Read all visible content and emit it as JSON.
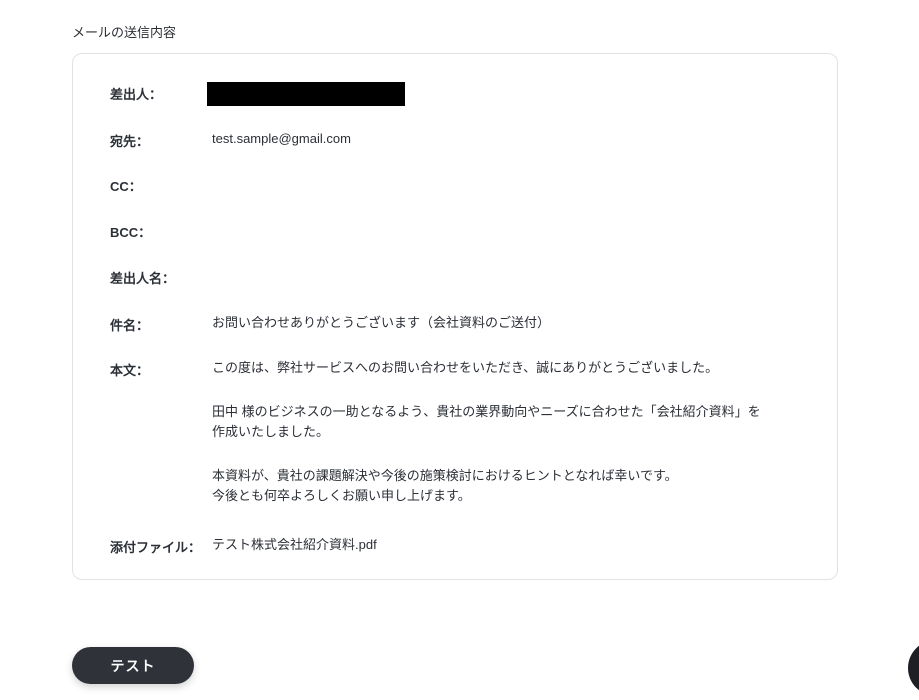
{
  "section_title": "メールの送信内容",
  "fields": {
    "sender": {
      "label": "差出人："
    },
    "to": {
      "label": "宛先：",
      "value": "test.sample@gmail.com"
    },
    "cc": {
      "label": "CC："
    },
    "bcc": {
      "label": "BCC："
    },
    "sender_name": {
      "label": "差出人名："
    },
    "subject": {
      "label": "件名：",
      "value": "お問い合わせありがとうございます（会社資料のご送付）"
    },
    "body": {
      "label": "本文：",
      "lines": [
        "この度は、弊社サービスへのお問い合わせをいただき、誠にありがとうございました。",
        "田中 様のビジネスの一助となるよう、貴社の業界動向やニーズに合わせた「会社紹介資料」を",
        "作成いたしました。",
        "本資料が、貴社の課題解決や今後の施策検討におけるヒントとなれば幸いです。",
        "今後とも何卒よろしくお願い申し上げます。"
      ]
    },
    "attachment": {
      "label": "添付ファイル：",
      "value": "テスト株式会社紹介資料.pdf"
    }
  },
  "test_button_label": "テスト"
}
